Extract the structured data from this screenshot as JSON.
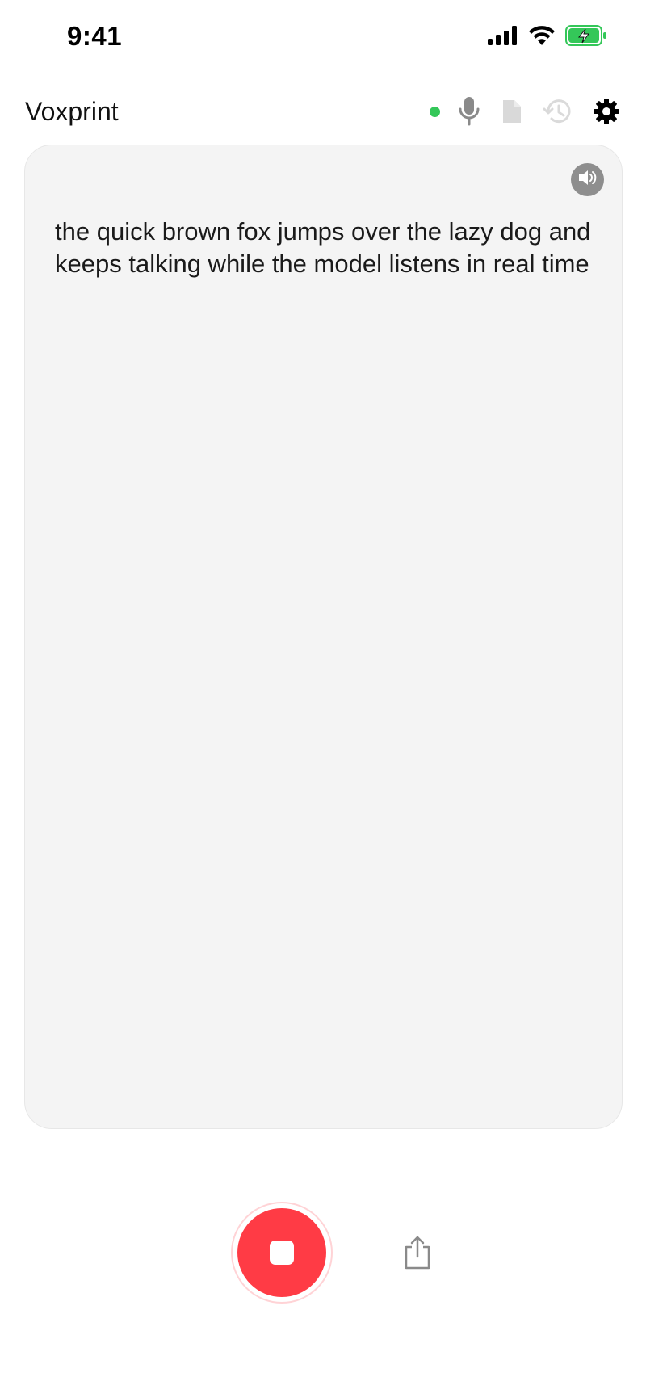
{
  "status_bar": {
    "time": "9:41",
    "icons": [
      "cellular-signal-icon",
      "wifi-icon",
      "battery-charging-icon"
    ]
  },
  "header": {
    "title": "Voxprint",
    "status_dot_color": "#34c759",
    "icons": [
      "microphone-icon",
      "document-icon",
      "history-icon",
      "gear-icon"
    ]
  },
  "transcript": {
    "text": "the quick brown fox jumps over the lazy dog and keeps talking while the model listens in real time",
    "speaker_icon": "speaker-icon"
  },
  "controls": {
    "record_state": "recording",
    "record_color": "#ff3b45",
    "icons": [
      "stop-icon",
      "share-icon"
    ]
  }
}
